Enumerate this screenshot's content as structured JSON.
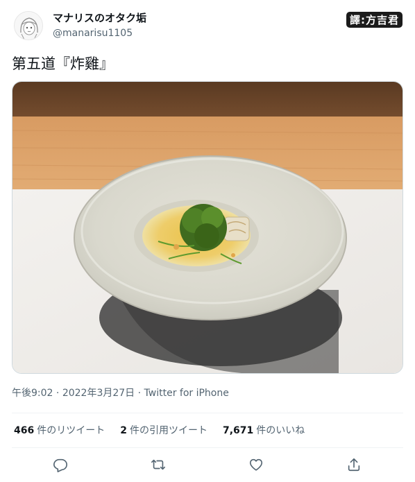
{
  "user": {
    "display_name": "マナリスのオタク垢",
    "handle": "@manarisu1105"
  },
  "watermark": "譯:方吉君",
  "tweet": {
    "text": "第五道『炸雞』"
  },
  "meta": {
    "time": "午後9:02",
    "sep1": " · ",
    "date": "2022年3月27日",
    "sep2": " · ",
    "source": "Twitter for iPhone"
  },
  "stats": {
    "retweets": {
      "count": "466",
      "label": "件のリツイート"
    },
    "quotes": {
      "count": "2",
      "label": "件の引用ツイート"
    },
    "likes": {
      "count": "7,671",
      "label": "件のいいね"
    }
  },
  "actions": {
    "reply_icon": "reply-icon",
    "retweet_icon": "retweet-icon",
    "like_icon": "heart-icon",
    "share_icon": "share-icon"
  },
  "colors": {
    "text_primary": "#0f1419",
    "text_secondary": "#536471",
    "divider": "#eff3f4"
  }
}
